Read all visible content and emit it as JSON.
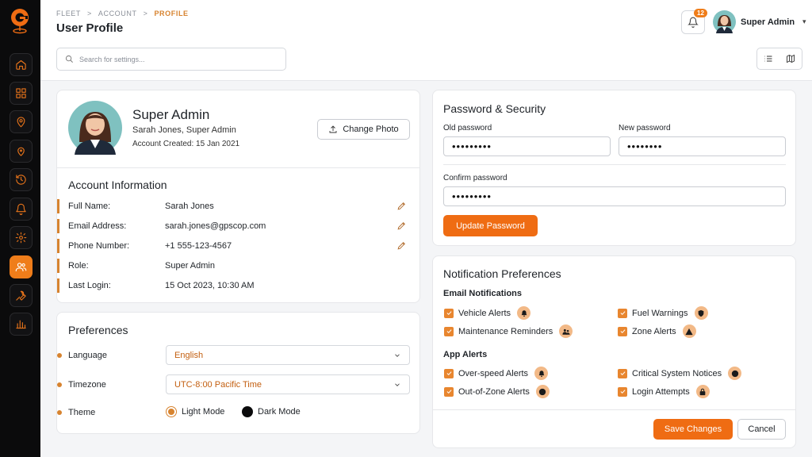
{
  "header": {
    "breadcrumbs": [
      "FLEET",
      "ACCOUNT",
      "PROFILE"
    ],
    "breadcrumb_separator": ">",
    "page_title": "User Profile",
    "search_placeholder": "Search for settings...",
    "notification_count": "12",
    "user_name": "Super Admin"
  },
  "sidebar": {
    "items": [
      {
        "icon": "home-icon"
      },
      {
        "icon": "grid-icon"
      },
      {
        "icon": "map-pin-icon"
      },
      {
        "icon": "location-icon"
      },
      {
        "icon": "history-icon"
      },
      {
        "icon": "bell-icon"
      },
      {
        "icon": "gear-icon"
      },
      {
        "icon": "users-icon",
        "active": true
      },
      {
        "icon": "wrench-icon"
      },
      {
        "icon": "bar-chart-icon"
      }
    ]
  },
  "profile": {
    "name": "Super Admin",
    "subtitle": "Sarah Jones, Super Admin",
    "created": "Account Created: 15 Jan 2021",
    "change_photo_label": "Change Photo"
  },
  "account_info": {
    "title": "Account Information",
    "rows": [
      {
        "label": "Full Name:",
        "value": "Sarah Jones",
        "editable": true
      },
      {
        "label": "Email Address:",
        "value": "sarah.jones@gpscop.com",
        "editable": true
      },
      {
        "label": "Phone Number:",
        "value": "+1 555-123-4567",
        "editable": true
      },
      {
        "label": "Role:",
        "value": "Super Admin",
        "editable": false
      },
      {
        "label": "Last Login:",
        "value": "15 Oct 2023, 10:30 AM",
        "editable": false
      }
    ]
  },
  "preferences": {
    "title": "Preferences",
    "language_label": "Language",
    "language_value": "English",
    "timezone_label": "Timezone",
    "timezone_value": "UTC-8:00 Pacific Time",
    "theme_label": "Theme",
    "theme_light": "Light Mode",
    "theme_dark": "Dark Mode",
    "theme_selected": "Light Mode"
  },
  "security": {
    "title": "Password & Security",
    "old_label": "Old password",
    "old_value": "•••••••••",
    "new_label": "New password",
    "new_value": "••••••••",
    "confirm_label": "Confirm password",
    "confirm_value": "•••••••••",
    "update_label": "Update Password"
  },
  "notifications": {
    "title": "Notification Preferences",
    "email_heading": "Email Notifications",
    "email_items": [
      {
        "label": "Vehicle Alerts",
        "icon": "bell-icon",
        "checked": true
      },
      {
        "label": "Fuel Warnings",
        "icon": "shield-icon",
        "checked": true
      },
      {
        "label": "Maintenance Reminders",
        "icon": "team-icon",
        "checked": true
      },
      {
        "label": "Zone Alerts",
        "icon": "warning-icon",
        "checked": true
      }
    ],
    "app_heading": "App Alerts",
    "app_items": [
      {
        "label": "Over-speed Alerts",
        "icon": "bell-icon",
        "checked": true
      },
      {
        "label": "Critical System Notices",
        "icon": "alert-circle-icon",
        "checked": true
      },
      {
        "label": "Out-of-Zone Alerts",
        "icon": "compass-icon",
        "checked": true
      },
      {
        "label": "Login Attempts",
        "icon": "lock-icon",
        "checked": true
      }
    ],
    "save_label": "Save Changes",
    "cancel_label": "Cancel"
  },
  "colors": {
    "accent": "#ef6c13",
    "sidebar_bg": "#0b0b0c",
    "label_bar": "#d7832f"
  }
}
